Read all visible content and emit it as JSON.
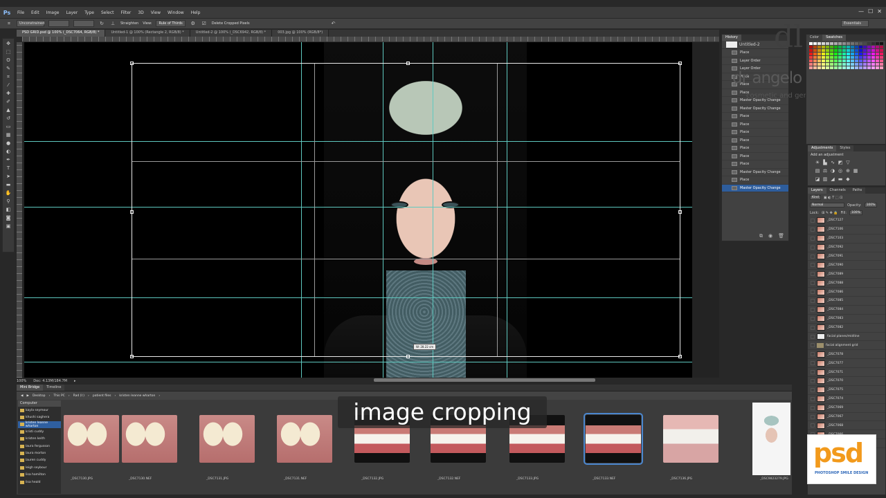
{
  "app": {
    "logo": "Ps"
  },
  "menu": [
    "File",
    "Edit",
    "Image",
    "Layer",
    "Type",
    "Select",
    "Filter",
    "3D",
    "View",
    "Window",
    "Help"
  ],
  "window_controls": [
    "—",
    "☐",
    "✕"
  ],
  "options_bar": {
    "ratio": "Unconstrained",
    "straighten_label": "Straighten",
    "view_label": "View:",
    "view_value": "Rule of Thirds",
    "delete_label": "Delete Cropped Pixels",
    "workspace": "Essentials"
  },
  "tabs": [
    "PSD GRID.psd @ 100% (_DSC7064, RGB/8) *",
    "Untitled-1 @ 100% (Rectangle 2, RGB/8) *",
    "Untitled-2 @ 100% (_DSC6942, RGB/8) *",
    "003.jpg @ 100% (RGB/8*)"
  ],
  "status": {
    "zoom": "100%",
    "doc": "Doc: 4.13M/184.7M"
  },
  "crop_readout": "W: 28.22 cm",
  "history": {
    "tabs": [
      "History"
    ],
    "snapshot": "Untitled-2",
    "items": [
      "Place",
      "Layer Order",
      "Layer Order",
      "Place",
      "Place",
      "Place",
      "Master Opacity Change",
      "Master Opacity Change",
      "Place",
      "Place",
      "Place",
      "Place",
      "Place",
      "Place",
      "Place",
      "Master Opacity Change",
      "Place",
      "Master Opacity Change"
    ]
  },
  "watermark": {
    "monogram": "dl",
    "name": "dr angelo lazaris",
    "subtitle": "cosmetic and general dentistry"
  },
  "swatches_tabs": [
    "Color",
    "Swatches"
  ],
  "adjustments": {
    "tabs": [
      "Adjustments",
      "Styles"
    ],
    "title": "Add an adjustment"
  },
  "layers": {
    "tabs": [
      "Layers",
      "Channels",
      "Paths"
    ],
    "kind": "Kind",
    "blend": "Normal",
    "opacity_label": "Opacity:",
    "opacity": "100%",
    "lock_label": "Lock:",
    "fill_label": "Fill:",
    "fill": "100%",
    "items": [
      "_DSC7127",
      "_DSC7106",
      "_DSC7103",
      "_DSC7092",
      "_DSC7091",
      "_DSC7090",
      "_DSC7089",
      "_DSC7088",
      "_DSC7086",
      "_DSC7085",
      "_DSC7084",
      "_DSC7083",
      "_DSC7082",
      "facial planes/midline",
      "facial alignment grid",
      "_DSC7078",
      "_DSC7077",
      "_DSC7071",
      "_DSC7070",
      "_DSC7075",
      "_DSC7074",
      "_DSC7069",
      "_DSC7067",
      "_DSC7068",
      "_DSC7066",
      "_DSC7065"
    ]
  },
  "bridge": {
    "tabs": [
      "Mini Bridge",
      "Timeline"
    ],
    "path": [
      "Desktop",
      "This PC",
      "Rad (I:)",
      "patient files",
      "kristen leanne wharton"
    ],
    "folder_header": "Computer",
    "folders": [
      "kayla seymour",
      "khushi saghera",
      "kristen leanne wharton",
      "kristi cuddy",
      "kristen keith",
      "laura fergusson",
      "laura morton",
      "lauren cuddy",
      "leigh seybour",
      "lisa hamilton",
      "lisa heald"
    ],
    "thumbs": [
      "_DSC7130.JPG",
      "_DSC7130.NEF",
      "_DSC7131.JPG",
      "_DSC7131.NEF",
      "_DSC7132.JPG",
      "_DSC7132.NEF",
      "_DSC7133.JPG",
      "_DSC7133.NEF",
      "_DSC7136.JPG"
    ],
    "portrait_label": "_DSC9823279.JPG"
  },
  "caption": "image cropping",
  "logo": {
    "text": "psd",
    "subtitle": "PHOTOSHOP SMILE DESIGN"
  },
  "colors": {
    "accent": "#2e5d9c",
    "guides": "#5fc9c0",
    "logo_orange": "#f29a1c",
    "logo_blue": "#2b66b8"
  }
}
